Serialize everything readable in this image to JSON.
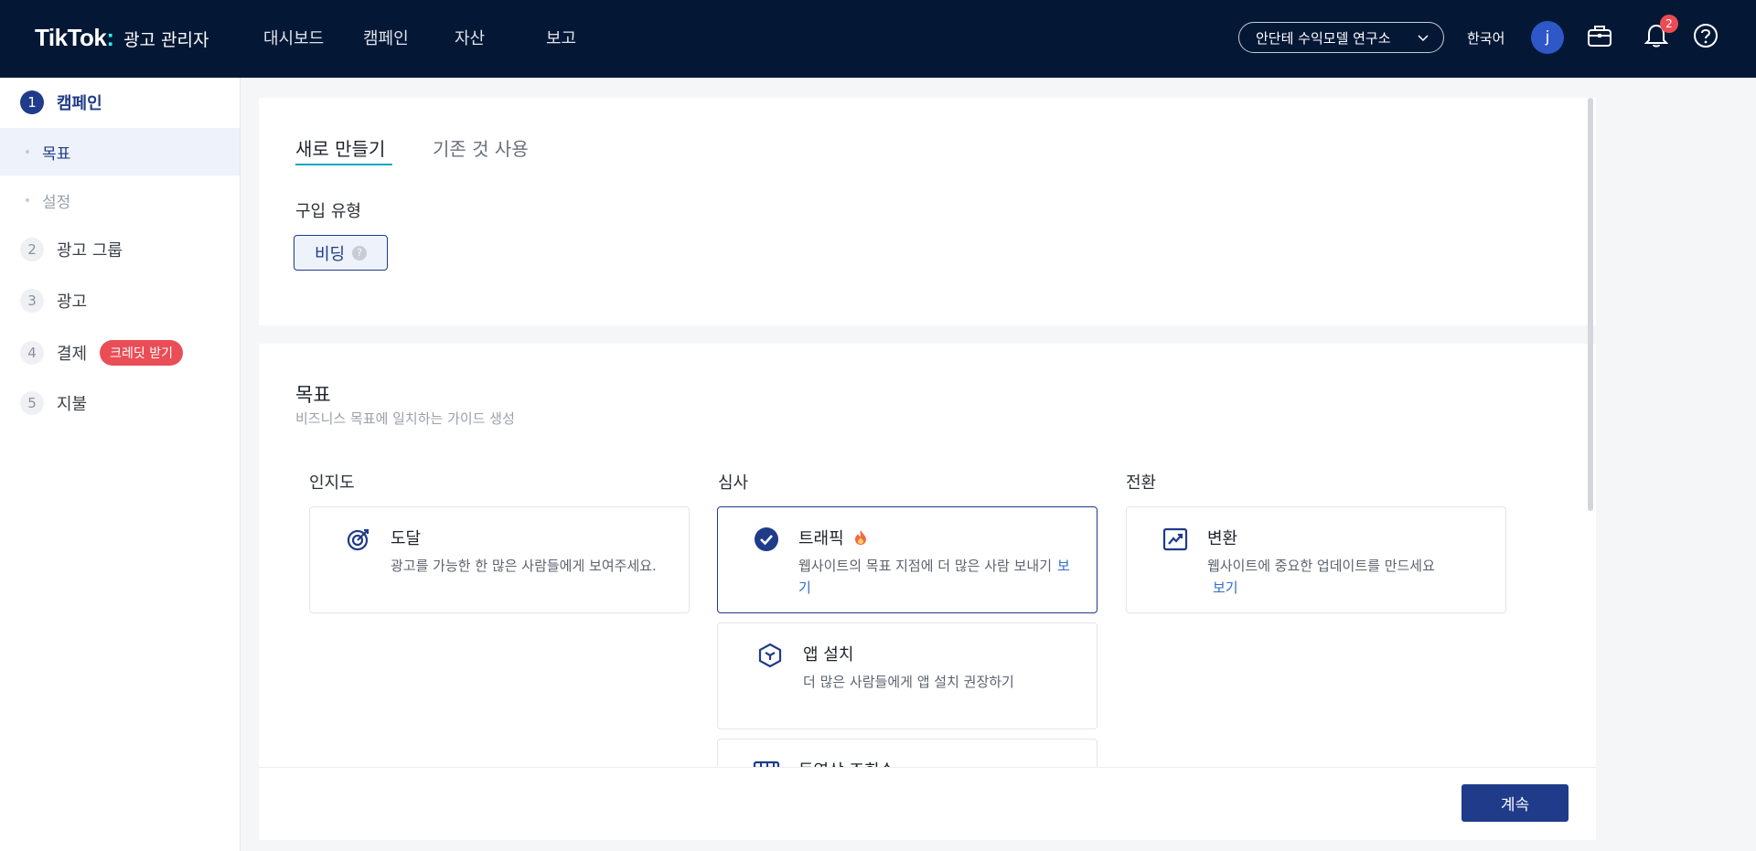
{
  "topbar": {
    "brand": "TikTok",
    "brand_sub": "광고 관리자",
    "nav": [
      "대시보드",
      "캠페인",
      "자산",
      "보고"
    ],
    "account": "안단테 수익모델 연구소",
    "language": "한국어",
    "avatar_letter": "j",
    "notification_count": "2"
  },
  "sidebar": {
    "steps": [
      {
        "num": "1",
        "label": "캠페인"
      },
      {
        "num": "2",
        "label": "광고 그룹"
      },
      {
        "num": "3",
        "label": "광고"
      },
      {
        "num": "4",
        "label": "결제"
      },
      {
        "num": "5",
        "label": "지불"
      }
    ],
    "substeps": [
      "목표",
      "설정"
    ],
    "credit_tag": "크레딧 받기"
  },
  "setup": {
    "tabs": [
      "새로 만들기",
      "기존 것 사용"
    ],
    "purchase_type_label": "구입 유형",
    "bidding_label": "비딩",
    "help": "?"
  },
  "goal": {
    "title": "목표",
    "subtitle": "비즈니스 목표에 일치하는 가이드 생성",
    "columns": [
      "인지도",
      "심사",
      "전환"
    ],
    "cards": {
      "reach": {
        "title": "도달",
        "desc": "광고를 가능한 한 많은 사람들에게 보여주세요."
      },
      "traffic": {
        "title": "트래픽",
        "desc": "웹사이트의 목표 지점에 더 많은 사람 보내기",
        "link": "보기"
      },
      "conversion": {
        "title": "변환",
        "desc": "웹사이트에 중요한 업데이트를 만드세요",
        "link": "보기"
      },
      "app_install": {
        "title": "앱 설치",
        "desc": "더 많은 사람들에게 앱 설치 권장하기"
      },
      "video_views": {
        "title": "동영상 조회수"
      }
    }
  },
  "footer": {
    "continue": "계속"
  }
}
